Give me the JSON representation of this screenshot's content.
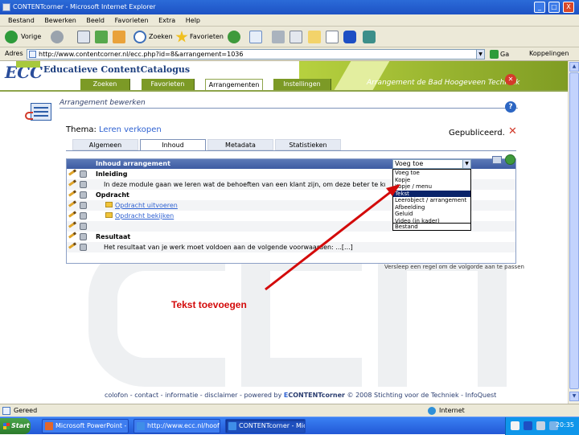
{
  "window": {
    "title": "CONTENTcorner - Microsoft Internet Explorer",
    "min": "_",
    "max": "□",
    "close": "X"
  },
  "menu": [
    "Bestand",
    "Bewerken",
    "Beeld",
    "Favorieten",
    "Extra",
    "Help"
  ],
  "toolbar": {
    "back": "Vorige",
    "search": "Zoeken",
    "favorites": "Favorieten"
  },
  "address": {
    "label": "Adres",
    "url": "http://www.contentcorner.nl/ecc.php?id=8&arrangement=1036",
    "go": "Ga naar",
    "links": "Koppelingen"
  },
  "app": {
    "logo": "ECC",
    "title": "Educatieve ContentCatalogus",
    "org": "Arrangement de Bad Hoogeveen Techniek",
    "tabs": [
      "Zoeken",
      "Favorieten",
      "Arrangementen",
      "Instellingen"
    ],
    "active_tab": 2
  },
  "section": {
    "title": "Arrangement bewerken",
    "help": "?"
  },
  "arrangement": {
    "theme_label": "Thema:",
    "theme_value": "Leren verkopen",
    "status": "Gepubliceerd.",
    "status_x": "✕"
  },
  "subtabs": [
    "Algemeen",
    "Inhoud",
    "Metadata",
    "Statistieken"
  ],
  "active_subtab": 1,
  "content": {
    "header": "Inhoud arrangement",
    "rows": [
      {
        "text": "Inleiding",
        "type": "heading",
        "indent": 0
      },
      {
        "text": "In deze module gaan we leren wat de behoeften van een klant zijn, om deze beter te kunnen helpen in het verkoopgesprek. Als[...]",
        "type": "text",
        "indent": 0
      },
      {
        "text": "Opdracht",
        "type": "heading",
        "indent": 0
      },
      {
        "text": "Opdracht uitvoeren",
        "type": "link",
        "indent": 1
      },
      {
        "text": "Opdracht bekijken",
        "type": "link",
        "indent": 1
      },
      {
        "text": "",
        "type": "empty",
        "indent": 0
      },
      {
        "text": "Resultaat",
        "type": "heading",
        "indent": 0
      },
      {
        "text": "Het resultaat van je werk moet voldoen aan de volgende voorwaarden: ...[...]",
        "type": "text",
        "indent": 0
      }
    ]
  },
  "dropdown": {
    "selected": "Voeg toe",
    "options": [
      "Voeg toe",
      "Kopje",
      "Kopje / menu",
      "Tekst",
      "Leerobject / arrangement",
      "Afbeelding",
      "Geluid",
      "Video (in kader)",
      "Bestand"
    ],
    "highlighted": 3
  },
  "hint": "Versleep een regel om de volgorde aan te passen",
  "annotation": "Tekst toevoegen",
  "footer": {
    "items": [
      "colofon",
      "contact",
      "informatie",
      "disclaimer"
    ],
    "powered": "powered by",
    "brand_e": "E",
    "brand": "CONTENTcorner",
    "copyright": "© 2008 Stichting voor de Techniek - InfoQuest"
  },
  "statusbar": {
    "text": "Gereed",
    "zone": "Internet"
  },
  "taskbar": {
    "start": "Start",
    "tasks": [
      "Microsoft PowerPoint - [...]",
      "http://www.ecc.nl/hoofdpagina...",
      "CONTENTcorner - Micr..."
    ],
    "active_task": 2,
    "clock": "20:35"
  },
  "colors": {
    "accent_green": "#8ea44a",
    "header_blue": "#3d5ba1",
    "link_blue": "#2f62d2",
    "annotation_red": "#d30a0a"
  }
}
